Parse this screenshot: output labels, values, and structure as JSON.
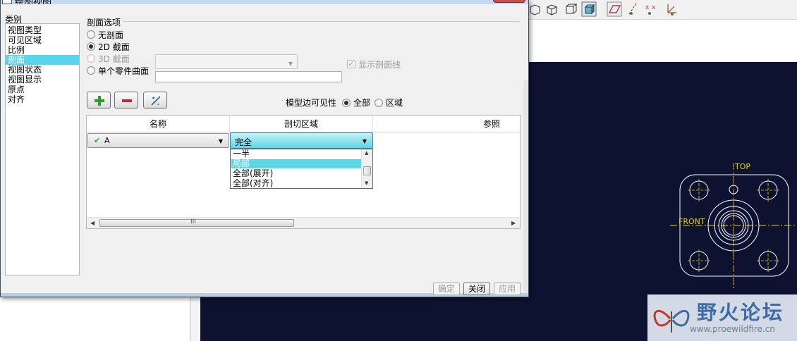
{
  "dialog": {
    "title": "绘图视图",
    "category_caption": "类别",
    "categories": [
      "视图类型",
      "可见区域",
      "比例",
      "剖面",
      "视图状态",
      "视图显示",
      "原点",
      "对齐"
    ],
    "selected_category": "剖面",
    "section_options": {
      "caption": "剖面选项",
      "no_section": "无剖面",
      "section_2d": "2D 截面",
      "section_3d": "3D 截面",
      "single_part_surface": "单个零件曲面",
      "show_hatch": "显示剖面线",
      "selected": "2D 截面"
    },
    "tools": {
      "add_icon": "plus-icon",
      "remove_icon": "minus-icon",
      "edit_icon": "edit-section-icon"
    },
    "model_edge_visibility": {
      "label": "模型边可见性",
      "all": "全部",
      "region": "区域",
      "selected": "全部"
    },
    "table": {
      "columns": [
        "名称",
        "剖切区域",
        "参照"
      ],
      "rows": [
        {
          "name": "A",
          "region": "完全"
        }
      ]
    },
    "region_dropdown": {
      "options": [
        "一半",
        "局部",
        "全部(展开)",
        "全部(对齐)"
      ],
      "highlighted": "局部"
    },
    "buttons": {
      "ok": "确定",
      "close": "关闭",
      "apply": "应用"
    }
  },
  "model": {
    "label_top": "TOP",
    "label_front": "FRONT"
  },
  "watermark": {
    "title": "野火论坛",
    "url": "www.proewildfire.cn"
  },
  "colors": {
    "graphics_bg": "#0c1230",
    "selection": "#56d6ea",
    "model_lines": "#ffffff",
    "datum": "#e6d400"
  }
}
